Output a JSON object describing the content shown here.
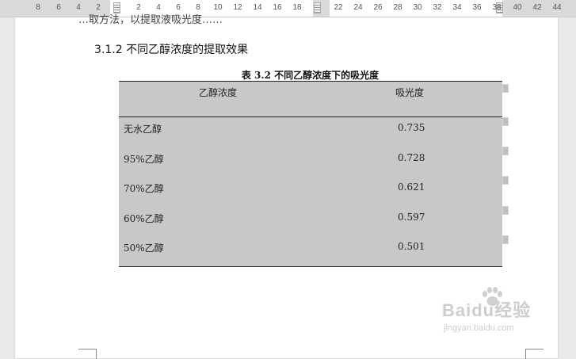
{
  "ruler": {
    "numbers": [
      "8",
      "6",
      "4",
      "2",
      "2",
      "4",
      "6",
      "8",
      "10",
      "12",
      "14",
      "16",
      "18",
      "22",
      "24",
      "26",
      "28",
      "30",
      "32",
      "34",
      "36",
      "38",
      "40",
      "42",
      "44"
    ]
  },
  "document": {
    "cut_text": "…取方法，以提取液吸光度……",
    "section_heading": "3.1.2 不同乙醇浓度的提取效果",
    "table_caption": "表 3.2  不同乙醇浓度下的吸光度",
    "table": {
      "headers": [
        "乙醇浓度",
        "吸光度"
      ],
      "rows": [
        {
          "name": "无水乙醇",
          "value": "0.735"
        },
        {
          "name": "95%乙醇",
          "value": "0.728"
        },
        {
          "name": "70%乙醇",
          "value": "0.621"
        },
        {
          "name": "60%乙醇",
          "value": "0.597"
        },
        {
          "name": "50%乙醇",
          "value": "0.501"
        }
      ]
    }
  },
  "watermark": {
    "logo": "Baidu经验",
    "url": "jingyan.baidu.com"
  },
  "colors": {
    "table_shading": "#c8c8c8",
    "page": "#ffffff",
    "background": "#e9e9e9"
  }
}
